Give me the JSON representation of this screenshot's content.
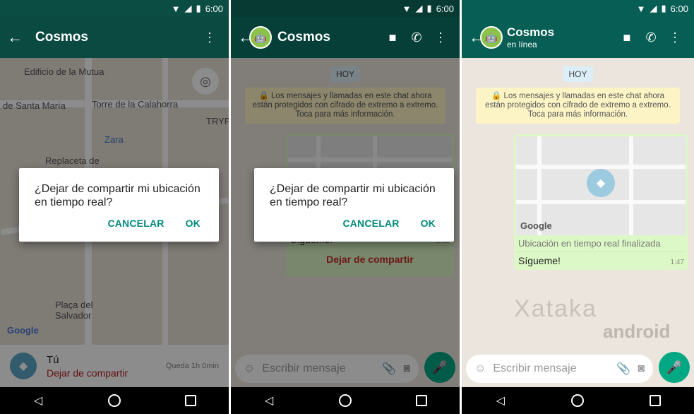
{
  "status": {
    "time": "6:00",
    "icons": [
      "wifi-icon",
      "signal-icon",
      "battery-icon"
    ]
  },
  "panel1": {
    "title": "Cosmos",
    "map_labels": [
      "Edificio de la Mutua",
      "de Santa María",
      "Torre de la Calahorra",
      "TRYP",
      "Zara",
      "Replaceta de",
      "Plaça del Salvador",
      "Google"
    ],
    "sheet": {
      "name": "Tú",
      "stop": "Dejar de compartir",
      "remaining": "Queda 1h 0min"
    }
  },
  "dialog": {
    "question": "¿Dejar de compartir mi ubicación en tiempo real?",
    "cancel": "CANCELAR",
    "ok": "OK"
  },
  "panel2": {
    "title": "Cosmos",
    "day": "HOY",
    "notice": "Los mensajes y llamadas en este chat ahora están protegidos con cifrado de extremo a extremo. Toca para más información.",
    "msg": "Sígueme!",
    "time": "1:48",
    "stop": "Dejar de compartir",
    "placeholder": "Escribir mensaje"
  },
  "panel3": {
    "title": "Cosmos",
    "subtitle": "en línea",
    "day": "HOY",
    "notice": "Los mensajes y llamadas en este chat ahora están protegidos con cifrado de extremo a extremo. Toca para más información.",
    "live_ended": "Ubicación en tiempo real finalizada",
    "msg": "Sígueme!",
    "time": "1:47",
    "placeholder": "Escribir mensaje",
    "google": "Google",
    "watermark_1": "Xataka",
    "watermark_2": "android"
  }
}
